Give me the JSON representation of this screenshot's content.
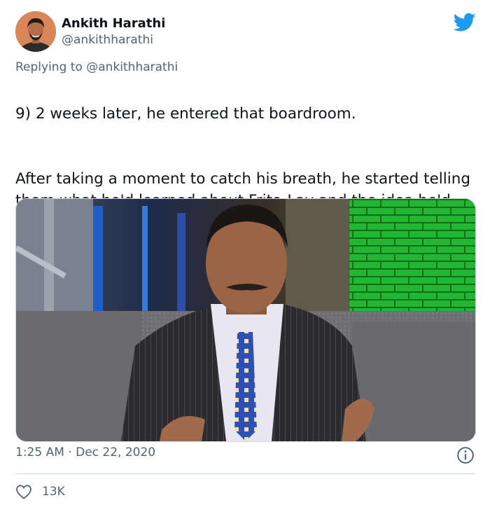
{
  "author": {
    "display_name": "Ankith Harathi",
    "handle": "@ankithharathi"
  },
  "reply": {
    "prefix": "Replying to ",
    "mention": "@ankithharathi"
  },
  "tweet": {
    "paragraphs": [
      "9) 2 weeks later, he entered that boardroom.",
      "After taking a moment to catch his breath, he started telling them what he'd learned about Frito-Lay and the idea he'd been working on."
    ]
  },
  "meta": {
    "time": "1:25 AM",
    "separator": " · ",
    "date": "Dec 22, 2020"
  },
  "engagement": {
    "likes": "13K"
  },
  "icons": {
    "brand": "twitter-bird-icon",
    "info": "info-icon",
    "like": "heart-icon"
  },
  "colors": {
    "brand_blue": "#1d9bf0",
    "secondary_text": "#536471",
    "primary_text": "#0f1419"
  }
}
